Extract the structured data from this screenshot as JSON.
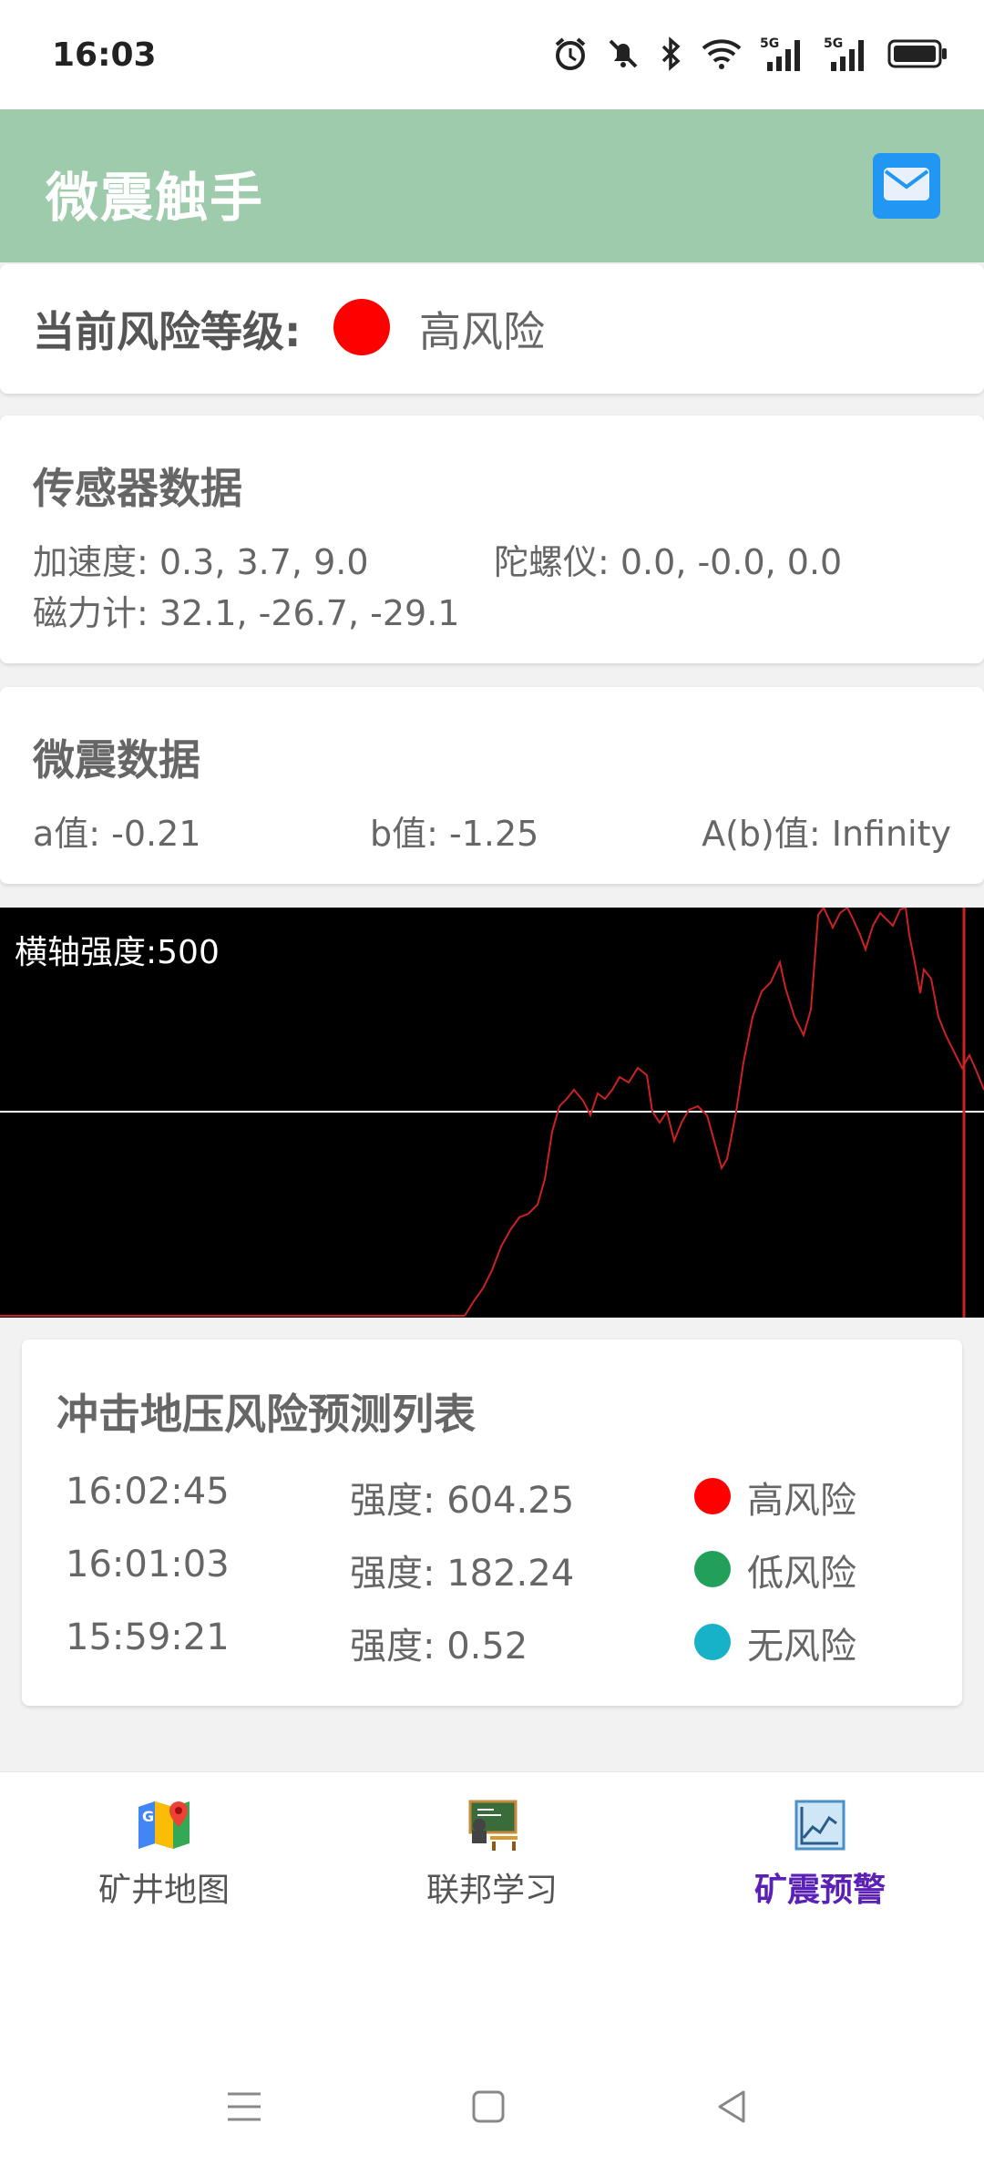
{
  "status_bar": {
    "time": "16:03",
    "icons": [
      "alarm-icon",
      "mute-icon",
      "bluetooth-icon",
      "wifi-icon",
      "signal-5g-icon",
      "signal-5g-icon",
      "battery-icon"
    ],
    "network_labels": [
      "5G",
      "5G"
    ]
  },
  "app_bar": {
    "title": "微震触手",
    "action_icon": "mail-icon",
    "accent": "#9ecbab"
  },
  "risk": {
    "label": "当前风险等级:",
    "value": "高风险",
    "color": "#ff0000"
  },
  "sensor": {
    "title": "传感器数据",
    "accelerometer": "加速度: 0.3, 3.7, 9.0",
    "gyroscope": "陀螺仪: 0.0, -0.0, 0.0",
    "magnetometer": "磁力计: 32.1, -26.7, -29.1"
  },
  "quake": {
    "title": "微震数据",
    "a_value": "a值: -0.21",
    "b_value": "b值: -1.25",
    "ab_value": "A(b)值: Infinity"
  },
  "chart": {
    "label": "横轴强度:500",
    "line_color": "#cc2222",
    "baseline_color": "#ffffff"
  },
  "predictions": {
    "title": "冲击地压风险预测列表",
    "rows": [
      {
        "time": "16:02:45",
        "strength": "强度: 604.25",
        "level": "高风险",
        "color": "#ff0000"
      },
      {
        "time": "16:01:03",
        "strength": "强度: 182.24",
        "level": "低风险",
        "color": "#22a05a"
      },
      {
        "time": "15:59:21",
        "strength": "强度: 0.52",
        "level": "无风险",
        "color": "#17b2c8"
      }
    ]
  },
  "nav": {
    "items": [
      {
        "label": "矿井地图",
        "icon": "map-icon",
        "active": false
      },
      {
        "label": "联邦学习",
        "icon": "classroom-icon",
        "active": false
      },
      {
        "label": "矿震预警",
        "icon": "chart-icon",
        "active": true
      }
    ],
    "active_color": "#5b21b6"
  },
  "system_nav": {
    "icons": [
      "menu-icon",
      "home-icon",
      "back-icon"
    ]
  }
}
